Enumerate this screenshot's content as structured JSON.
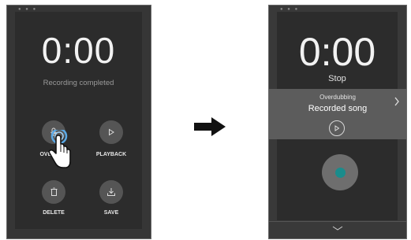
{
  "left": {
    "time": "0:00",
    "subtitle": "Recording completed",
    "buttons": {
      "overdub": "OVERDUB",
      "playback": "PLAYBACK",
      "delete": "DELETE",
      "save": "SAVE"
    }
  },
  "right": {
    "time": "0:00",
    "stop": "Stop",
    "overdubbing": "Overdubbing",
    "song": "Recorded song"
  },
  "icons": {
    "overdub": "microphone-icon",
    "playback": "play-icon",
    "delete": "trash-icon",
    "save": "download-icon",
    "record": "record-icon",
    "expand": "chevron-down-icon",
    "detail": "chevron-right-icon",
    "transition": "arrow-right-icon",
    "pointer": "hand-pointer-icon"
  },
  "colors": {
    "screen_bg": "#2c2c2c",
    "button_bg": "#555555",
    "record_dot": "#1a8c8c",
    "song_bar": "#5c5c5c"
  }
}
